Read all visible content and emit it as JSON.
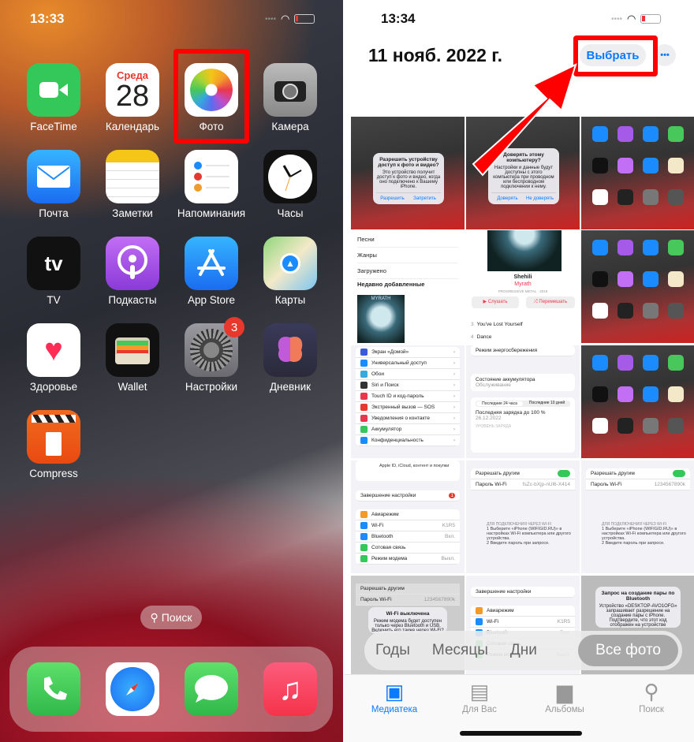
{
  "left": {
    "time": "13:33",
    "apps": [
      {
        "name": "FaceTime",
        "color": "#34c759"
      },
      {
        "name": "Календарь",
        "day": "Среда",
        "date": "28"
      },
      {
        "name": "Фото"
      },
      {
        "name": "Камера",
        "color": "#8e8e93"
      },
      {
        "name": "Почта",
        "color": "#1a8cff"
      },
      {
        "name": "Заметки"
      },
      {
        "name": "Напоминания"
      },
      {
        "name": "Часы"
      },
      {
        "name": "TV",
        "glyph": "tv"
      },
      {
        "name": "Подкасты",
        "color": "#a55ae8"
      },
      {
        "name": "App Store",
        "color": "#1a8cff"
      },
      {
        "name": "Карты"
      },
      {
        "name": "Здоровье"
      },
      {
        "name": "Wallet"
      },
      {
        "name": "Настройки",
        "badge": "3"
      },
      {
        "name": "Дневник"
      },
      {
        "name": "Compress"
      }
    ],
    "search": "Поиск",
    "dock": [
      "phone-icon",
      "safari-icon",
      "messages-icon",
      "music-icon"
    ]
  },
  "right": {
    "time": "13:34",
    "title": "11 нояб. 2022 г.",
    "select": "Выбрать",
    "more": "•••",
    "thumbs": {
      "alert1": {
        "title": "Разрешить устройству доступ к фото и видео?",
        "text": "Это устройство получит доступ к фото и видео, когда оно подключено к Вашему iPhone.",
        "allow": "Разрешить",
        "deny": "Запретить"
      },
      "alert2": {
        "title": "Доверять этому компьютеру?",
        "text": "Настройки и данные будут доступны с этого компьютера при проводном или беспроводном подключении к нему.",
        "trust": "Доверять",
        "distrust": "Не доверять"
      },
      "music": {
        "items": [
          "Песни",
          "Жанры",
          "Загружено"
        ],
        "recent": "Недавно добавленные",
        "cover": "MYRATH"
      },
      "album": {
        "title": "Shehili",
        "artist": "Myrath",
        "genre": "PROGRESSIVE METAL · 2019",
        "play": "▶ Слушать",
        "shuffle": "⤮ Перемешать",
        "tracks": [
          [
            "3",
            "You've Lost Yourself"
          ],
          [
            "4",
            "Dance"
          ]
        ]
      },
      "settings": {
        "items": [
          "Экран «Домой»",
          "Универсальный доступ",
          "Обои",
          "Siri и Поиск",
          "Touch ID и код-пароль",
          "Экстренный вызов — SOS",
          "Уведомления о контакте",
          "Аккумулятор",
          "Конфиденциальность"
        ],
        "colors": [
          "#3b5bdb",
          "#1a8cff",
          "#35aadc",
          "#333",
          "#e8374c",
          "#e8372c",
          "#e8374c",
          "#34c759",
          "#1a8cff"
        ]
      },
      "battery": {
        "lowpower": "Режим энергосбережения",
        "health": "Состояние аккумулятора",
        "service": "Обслуживание",
        "tab24": "Последние 24 часа",
        "tab10": "Последние 10 дней",
        "last": "Последняя зарядка до 100 %",
        "date": "26.12.2022",
        "level": "УРОВЕНЬ ЗАРЯДА"
      },
      "appleid": {
        "text": "Apple ID, iCloud, контент и покупки",
        "finish": "Завершение настройки",
        "rows": [
          [
            "Авиарежим",
            ""
          ],
          [
            "Wi-Fi",
            "K1R5"
          ],
          [
            "Bluetooth",
            "Вкл."
          ],
          [
            "Сотовая связь",
            ""
          ],
          [
            "Режим модема",
            "Выкл."
          ]
        ]
      },
      "hotspot": {
        "allow": "Разрешать другим",
        "pass": "Пароль Wi-Fi",
        "val1": "fsZc-bXjp-nUl6-X414",
        "val2": "1234567890k",
        "wifi_hint": "ДЛЯ ПОДКЛЮЧЕНИЯ ЧЕРЕЗ WI-FI",
        "step1": "1 Выберите «iPhone (WIFIGID.RU)» в настройках Wi-Fi компьютера или другого устройства.",
        "step2": "2 Введите пароль при запросе."
      },
      "wifioff": {
        "title": "Wi-Fi выключена",
        "text": "Режим модема будет доступен только через Bluetooth и USB. Включить его также через Wi-Fi?"
      },
      "bt": {
        "title": "Запрос на создание пары по Bluetooth",
        "text": "Устройство «DESKTOP-AVO1OFG» запрашивает разрешение на создание пары с iPhone. Подтвердите, что этот код отображен на устройстве"
      }
    },
    "segments": [
      "Годы",
      "Месяцы",
      "Дни",
      "Все фото"
    ],
    "selected_segment": "Все фото",
    "tabs": [
      "Медиатека",
      "Для Вас",
      "Альбомы",
      "Поиск"
    ],
    "active_tab": "Медиатека"
  },
  "colors": {
    "highlight": "#ff0000",
    "accent": "#0a7aff"
  }
}
